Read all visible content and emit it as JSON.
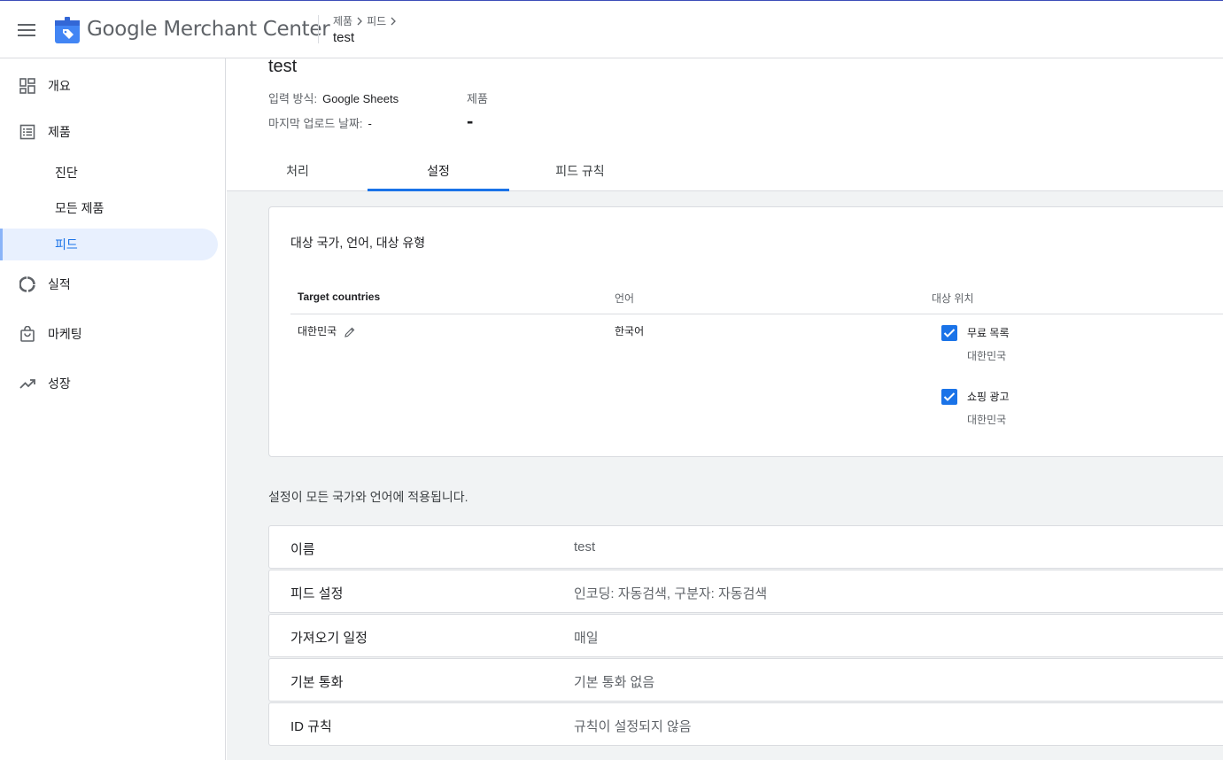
{
  "header": {
    "app_name_google": "Google",
    "app_name_rest": "Merchant Center",
    "breadcrumb": [
      "제품",
      "피드"
    ],
    "page_title": "test"
  },
  "sidebar": {
    "items": [
      {
        "label": "개요",
        "icon": "dashboard-icon"
      },
      {
        "label": "제품",
        "icon": "list-icon"
      },
      {
        "label": "진단"
      },
      {
        "label": "모든 제품"
      },
      {
        "label": "피드",
        "active": true
      },
      {
        "label": "실적",
        "icon": "donut-chart-icon"
      },
      {
        "label": "마케팅",
        "icon": "shopping-bag-icon"
      },
      {
        "label": "성장",
        "icon": "trending-up-icon"
      }
    ]
  },
  "feed": {
    "title": "test",
    "input_method_label": "입력 방식:",
    "input_method_value": "Google Sheets",
    "last_upload_label": "마지막 업로드 날짜:",
    "last_upload_value": "-",
    "products_label": "제품",
    "products_value": "-"
  },
  "tabs": [
    {
      "label": "처리"
    },
    {
      "label": "설정",
      "active": true
    },
    {
      "label": "피드 규칙"
    }
  ],
  "targets_card": {
    "title": "대상 국가, 언어, 대상 유형",
    "headers": {
      "countries": "Target countries",
      "language": "언어",
      "location": "대상 위치"
    },
    "country": "대한민국",
    "language": "한국어",
    "destinations": [
      {
        "label": "무료 목록",
        "sub": "대한민국",
        "checked": true
      },
      {
        "label": "쇼핑 광고",
        "sub": "대한민국",
        "checked": true
      }
    ]
  },
  "settings": {
    "note": "설정이 모든 국가와 언어에 적용됩니다.",
    "rows": [
      {
        "key": "이름",
        "value": "test"
      },
      {
        "key": "피드 설정",
        "value": "인코딩: 자동검색, 구분자: 자동검색"
      },
      {
        "key": "가져오기 일정",
        "value": "매일"
      },
      {
        "key": "기본 통화",
        "value": "기본 통화 없음"
      },
      {
        "key": "ID 규칙",
        "value": "규칙이 설정되지 않음"
      }
    ]
  },
  "colors": {
    "accent": "#1a73e8",
    "active_bg": "#e8f0fe",
    "content_bg": "#f1f3f4"
  }
}
